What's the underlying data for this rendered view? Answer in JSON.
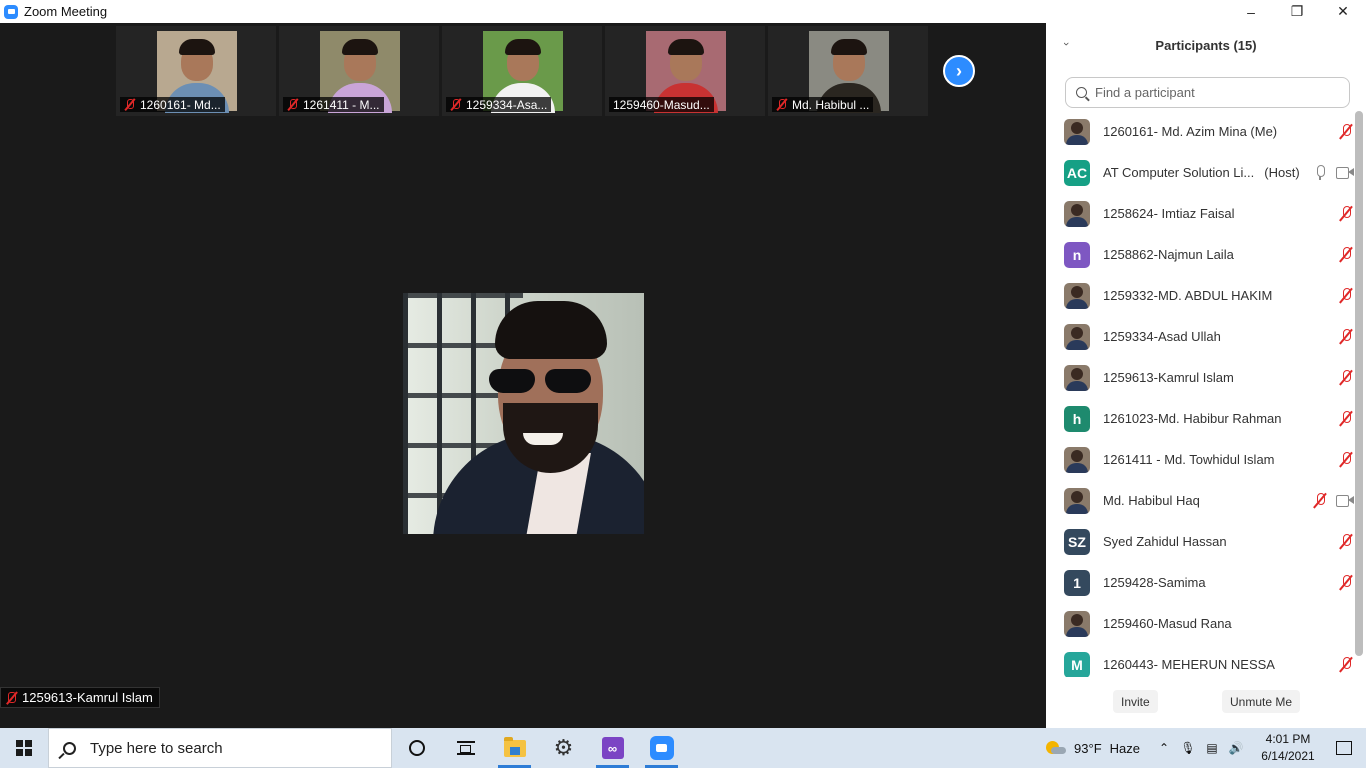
{
  "window": {
    "title": "Zoom Meeting",
    "controls": [
      "minimize",
      "maximize",
      "close"
    ]
  },
  "video_strip": {
    "tiles": [
      {
        "label": "1260161- Md...",
        "muted": true,
        "shirt": "#6c8fb4",
        "bg": "#b8a890"
      },
      {
        "label": "1261411 - M...",
        "muted": true,
        "shirt": "#c9a5d8",
        "bg": "#8f8a6a"
      },
      {
        "label": "1259334-Asa...",
        "muted": true,
        "shirt": "#f2f2f2",
        "bg": "#6a9a4a"
      },
      {
        "label": "1259460-Masud...",
        "muted": false,
        "shirt": "#c83232",
        "bg": "#a86a72"
      },
      {
        "label": "Md. Habibul ...",
        "muted": true,
        "shirt": "#2a2620",
        "bg": "#8a8a82"
      }
    ],
    "next_button_icon": "chevron-right-icon"
  },
  "active_speaker": {
    "name": "1259613-Kamrul Islam",
    "muted": true
  },
  "participants_panel": {
    "title": "Participants (15)",
    "search_placeholder": "Find a participant",
    "participants": [
      {
        "name": "1260161- Md. Azim Mina (Me)",
        "role": "",
        "avatar_type": "photo",
        "avatar_text": "",
        "avatar_color": "",
        "mic": "muted",
        "video": false
      },
      {
        "name": "AT Computer Solution Li...",
        "role": "(Host)",
        "avatar_type": "initials",
        "avatar_text": "AC",
        "avatar_color": "#16a085",
        "mic": "on",
        "video": true
      },
      {
        "name": "1258624- Imtiaz Faisal",
        "role": "",
        "avatar_type": "photo",
        "avatar_text": "",
        "avatar_color": "",
        "mic": "muted",
        "video": false
      },
      {
        "name": "1258862-Najmun Laila",
        "role": "",
        "avatar_type": "initials",
        "avatar_text": "n",
        "avatar_color": "#7e57c2",
        "mic": "muted",
        "video": false
      },
      {
        "name": "1259332-MD. ABDUL HAKIM",
        "role": "",
        "avatar_type": "photo",
        "avatar_text": "",
        "avatar_color": "",
        "mic": "muted",
        "video": false
      },
      {
        "name": "1259334-Asad Ullah",
        "role": "",
        "avatar_type": "photo",
        "avatar_text": "",
        "avatar_color": "",
        "mic": "muted",
        "video": false
      },
      {
        "name": "1259613-Kamrul Islam",
        "role": "",
        "avatar_type": "photo",
        "avatar_text": "",
        "avatar_color": "",
        "mic": "muted",
        "video": false
      },
      {
        "name": "1261023-Md. Habibur Rahman",
        "role": "",
        "avatar_type": "initials",
        "avatar_text": "h",
        "avatar_color": "#1e8a6e",
        "mic": "muted",
        "video": false
      },
      {
        "name": "1261411 - Md. Towhidul Islam",
        "role": "",
        "avatar_type": "photo",
        "avatar_text": "",
        "avatar_color": "",
        "mic": "muted",
        "video": false
      },
      {
        "name": "Md. Habibul Haq",
        "role": "",
        "avatar_type": "photo",
        "avatar_text": "",
        "avatar_color": "",
        "mic": "muted",
        "video": true
      },
      {
        "name": "Syed Zahidul Hassan",
        "role": "",
        "avatar_type": "initials",
        "avatar_text": "SZ",
        "avatar_color": "#34495e",
        "mic": "muted",
        "video": false
      },
      {
        "name": "1259428-Samima",
        "role": "",
        "avatar_type": "initials",
        "avatar_text": "1",
        "avatar_color": "#34495e",
        "mic": "muted",
        "video": false
      },
      {
        "name": "1259460-Masud Rana",
        "role": "",
        "avatar_type": "photo",
        "avatar_text": "",
        "avatar_color": "",
        "mic": "none",
        "video": false
      },
      {
        "name": "1260443- MEHERUN NESSA",
        "role": "",
        "avatar_type": "initials",
        "avatar_text": "M",
        "avatar_color": "#26a69a",
        "mic": "muted",
        "video": false
      }
    ],
    "footer": {
      "invite_label": "Invite",
      "unmute_label": "Unmute Me"
    }
  },
  "taskbar": {
    "search_placeholder": "Type here to search",
    "pinned": [
      "cortana-icon",
      "task-view-icon",
      "file-explorer-icon",
      "settings-icon",
      "visual-studio-icon",
      "zoom-icon"
    ],
    "weather": {
      "temp": "93°F",
      "condition": "Haze"
    },
    "clock": {
      "time": "4:01 PM",
      "date": "6/14/2021"
    }
  }
}
